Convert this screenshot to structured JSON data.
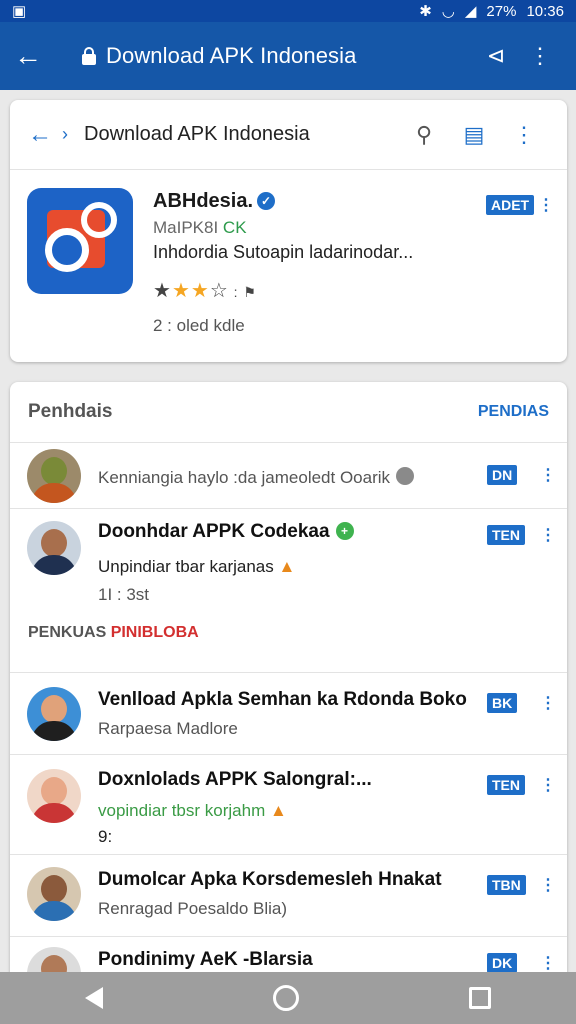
{
  "status_bar": {
    "battery": "27%",
    "time": "10:36"
  },
  "app_bar": {
    "title": "Download APK Indonesia"
  },
  "header_card": {
    "title": "Download APK Indonesia",
    "app": {
      "name": "ABHdesia.",
      "sub_prefix": "MaIPK8I ",
      "sub_ok": "CK",
      "desc": "Inhdordia Sutoapin ladarinodar...",
      "rating": 3,
      "rating_max": 5,
      "count": "2 : oled kdle",
      "badge": "ADET"
    }
  },
  "list_card": {
    "section_title": "Penhdais",
    "section_link": "PENDIAS",
    "rows": [
      {
        "title": "",
        "line1": "Kenniangia haylo :da jameoledt Ooarik",
        "badge": "DN"
      },
      {
        "title": "Doonhdar APPK Codekaa",
        "line1": "Unpindiar tbar karjanas",
        "line2": "1I : 3st",
        "badge": "TEN"
      }
    ],
    "sub_heading": "PENKUAS",
    "sub_heading_red": "PINIBLOBA",
    "rows2": [
      {
        "title": "Venlload Apkla Semhan ka Rdonda Boko",
        "line1": "Rarpaesa Madlore",
        "badge": "BK"
      },
      {
        "title": "Doxnlolads APPK Salongral:...",
        "line1": "vopindiar tbsr korjahm",
        "line2": "9:",
        "badge": "TEN"
      },
      {
        "title": "Dumolcar Apka Korsdemesleh Hnakat",
        "line1": "Renragad Poesaldo Blia)",
        "badge": "TBN"
      },
      {
        "title": "Pondinimy AeK -Blarsia",
        "line1": "",
        "badge": "DK"
      }
    ]
  },
  "colors": {
    "brand": "#1557a8",
    "accent": "#1e6ec8",
    "badge": "#1e6ec8"
  }
}
